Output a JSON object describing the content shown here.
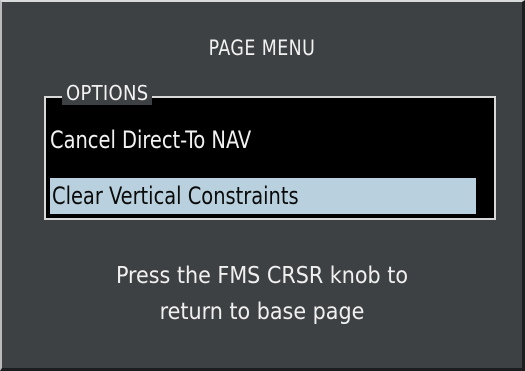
{
  "menu": {
    "title": "PAGE MENU",
    "options_label": "OPTIONS",
    "items": [
      {
        "label": "Cancel Direct-To NAV",
        "selected": false
      },
      {
        "label": "Clear Vertical Constraints",
        "selected": true
      }
    ],
    "instruction_line1": "Press the FMS CRSR knob to",
    "instruction_line2": "return to base page"
  },
  "colors": {
    "panel_bg": "#3e4144",
    "box_bg": "#000000",
    "highlight": "#b9d1de",
    "text": "#f2f2f2"
  }
}
